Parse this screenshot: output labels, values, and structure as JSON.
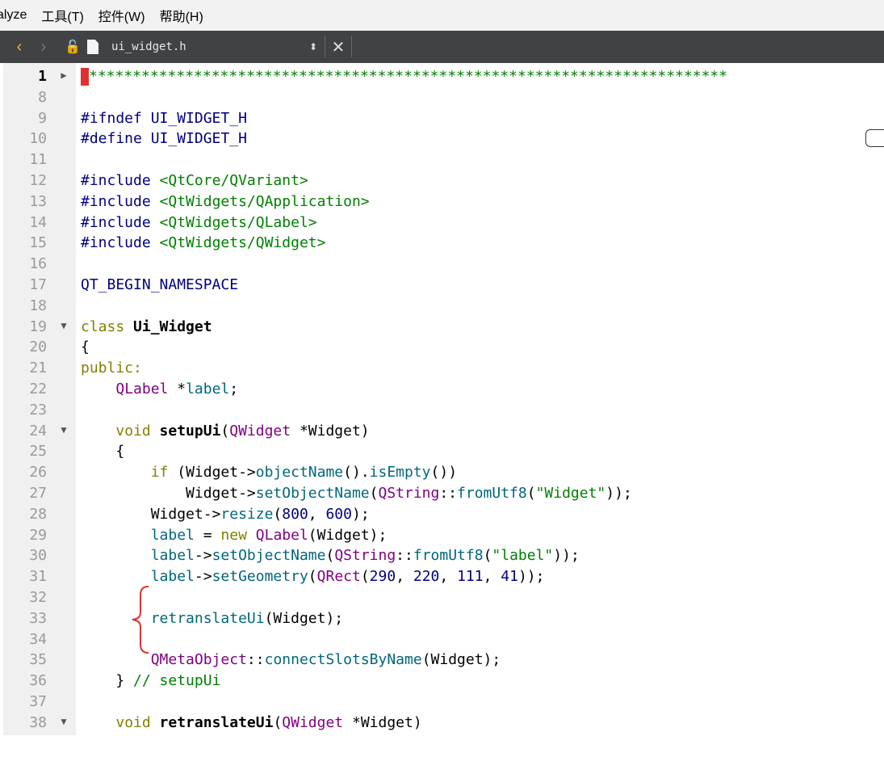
{
  "menu": {
    "items": [
      "alyze",
      "工具(T)",
      "控件(W)",
      "帮助(H)"
    ]
  },
  "toolbar": {
    "filename": "ui_widget.h",
    "back_icon": "chevron-left-icon",
    "forward_icon": "chevron-right-icon",
    "lock_icon": "unlock-icon",
    "file_icon": "file-icon",
    "updown_icon": "updown-icon",
    "close_icon": "close-icon"
  },
  "editor": {
    "lines": [
      {
        "n": "1",
        "fold": "▶",
        "cur": true,
        "tokens": [
          [
            "cursor",
            ""
          ],
          [
            "cm",
            "*************************************************************************"
          ]
        ]
      },
      {
        "n": "8",
        "tokens": []
      },
      {
        "n": "9",
        "tokens": [
          [
            "pp",
            "#ifndef UI_WIDGET_H"
          ]
        ]
      },
      {
        "n": "10",
        "tokens": [
          [
            "pp",
            "#define UI_WIDGET_H"
          ]
        ]
      },
      {
        "n": "11",
        "tokens": []
      },
      {
        "n": "12",
        "tokens": [
          [
            "pp",
            "#include "
          ],
          [
            "str",
            "<QtCore/QVariant>"
          ]
        ]
      },
      {
        "n": "13",
        "tokens": [
          [
            "pp",
            "#include "
          ],
          [
            "str",
            "<QtWidgets/QApplication>"
          ]
        ]
      },
      {
        "n": "14",
        "tokens": [
          [
            "pp",
            "#include "
          ],
          [
            "str",
            "<QtWidgets/QLabel>"
          ]
        ]
      },
      {
        "n": "15",
        "tokens": [
          [
            "pp",
            "#include "
          ],
          [
            "str",
            "<QtWidgets/QWidget>"
          ]
        ]
      },
      {
        "n": "16",
        "tokens": []
      },
      {
        "n": "17",
        "tokens": [
          [
            "pp",
            "QT_BEGIN_NAMESPACE"
          ]
        ]
      },
      {
        "n": "18",
        "tokens": []
      },
      {
        "n": "19",
        "fold": "▼",
        "tokens": [
          [
            "kw",
            "class "
          ],
          [
            "cls defn",
            "Ui_Widget"
          ]
        ]
      },
      {
        "n": "20",
        "tokens": [
          [
            "pl",
            "{"
          ]
        ]
      },
      {
        "n": "21",
        "tokens": [
          [
            "kw",
            "public:"
          ]
        ]
      },
      {
        "n": "22",
        "tokens": [
          [
            "pl",
            "    "
          ],
          [
            "cls",
            "QLabel"
          ],
          [
            "pl",
            " *"
          ],
          [
            "fn",
            "label"
          ],
          [
            "pl",
            ";"
          ]
        ]
      },
      {
        "n": "23",
        "tokens": []
      },
      {
        "n": "24",
        "fold": "▼",
        "tokens": [
          [
            "pl",
            "    "
          ],
          [
            "kw",
            "void "
          ],
          [
            "defn",
            "setupUi"
          ],
          [
            "pl",
            "("
          ],
          [
            "cls",
            "QWidget"
          ],
          [
            "pl",
            " *Widget)"
          ]
        ]
      },
      {
        "n": "25",
        "tokens": [
          [
            "pl",
            "    {"
          ]
        ]
      },
      {
        "n": "26",
        "tokens": [
          [
            "pl",
            "        "
          ],
          [
            "kw",
            "if"
          ],
          [
            "pl",
            " (Widget->"
          ],
          [
            "fn",
            "objectName"
          ],
          [
            "pl",
            "()."
          ],
          [
            "fn",
            "isEmpty"
          ],
          [
            "pl",
            "())"
          ]
        ]
      },
      {
        "n": "27",
        "tokens": [
          [
            "pl",
            "            Widget->"
          ],
          [
            "fn",
            "setObjectName"
          ],
          [
            "pl",
            "("
          ],
          [
            "cls",
            "QString"
          ],
          [
            "pl",
            "::"
          ],
          [
            "fn",
            "fromUtf8"
          ],
          [
            "pl",
            "("
          ],
          [
            "str",
            "\"Widget\""
          ],
          [
            "pl",
            "));"
          ]
        ]
      },
      {
        "n": "28",
        "tokens": [
          [
            "pl",
            "        Widget->"
          ],
          [
            "fn",
            "resize"
          ],
          [
            "pl",
            "("
          ],
          [
            "num",
            "800"
          ],
          [
            "pl",
            ", "
          ],
          [
            "num",
            "600"
          ],
          [
            "pl",
            ");"
          ]
        ]
      },
      {
        "n": "29",
        "tokens": [
          [
            "pl",
            "        "
          ],
          [
            "fn",
            "label"
          ],
          [
            "pl",
            " = "
          ],
          [
            "kw",
            "new "
          ],
          [
            "cls",
            "QLabel"
          ],
          [
            "pl",
            "(Widget);"
          ]
        ]
      },
      {
        "n": "30",
        "tokens": [
          [
            "pl",
            "        "
          ],
          [
            "fn",
            "label"
          ],
          [
            "pl",
            "->"
          ],
          [
            "fn",
            "setObjectName"
          ],
          [
            "pl",
            "("
          ],
          [
            "cls",
            "QString"
          ],
          [
            "pl",
            "::"
          ],
          [
            "fn",
            "fromUtf8"
          ],
          [
            "pl",
            "("
          ],
          [
            "str",
            "\"label\""
          ],
          [
            "pl",
            "));"
          ]
        ]
      },
      {
        "n": "31",
        "tokens": [
          [
            "pl",
            "        "
          ],
          [
            "fn",
            "label"
          ],
          [
            "pl",
            "->"
          ],
          [
            "fn",
            "setGeometry"
          ],
          [
            "pl",
            "("
          ],
          [
            "cls",
            "QRect"
          ],
          [
            "pl",
            "("
          ],
          [
            "num",
            "290"
          ],
          [
            "pl",
            ", "
          ],
          [
            "num",
            "220"
          ],
          [
            "pl",
            ", "
          ],
          [
            "num",
            "111"
          ],
          [
            "pl",
            ", "
          ],
          [
            "num",
            "41"
          ],
          [
            "pl",
            "));"
          ]
        ]
      },
      {
        "n": "32",
        "tokens": []
      },
      {
        "n": "33",
        "tokens": [
          [
            "pl",
            "        "
          ],
          [
            "fn",
            "retranslateUi"
          ],
          [
            "pl",
            "(Widget);"
          ]
        ]
      },
      {
        "n": "34",
        "tokens": []
      },
      {
        "n": "35",
        "tokens": [
          [
            "pl",
            "        "
          ],
          [
            "cls",
            "QMetaObject"
          ],
          [
            "pl",
            "::"
          ],
          [
            "fn",
            "connectSlotsByName"
          ],
          [
            "pl",
            "(Widget);"
          ]
        ]
      },
      {
        "n": "36",
        "tokens": [
          [
            "pl",
            "    } "
          ],
          [
            "cm",
            "// setupUi"
          ]
        ]
      },
      {
        "n": "37",
        "tokens": []
      },
      {
        "n": "38",
        "fold": "▼",
        "tokens": [
          [
            "pl",
            "    "
          ],
          [
            "kw",
            "void "
          ],
          [
            "defn",
            "retranslateUi"
          ],
          [
            "pl",
            "("
          ],
          [
            "cls",
            "QWidget"
          ],
          [
            "pl",
            " *Widget)"
          ]
        ]
      }
    ]
  },
  "colors": {
    "toolbar_bg": "#404244",
    "gutter_bg": "#f0f0f0",
    "annotation": "#e03030"
  }
}
